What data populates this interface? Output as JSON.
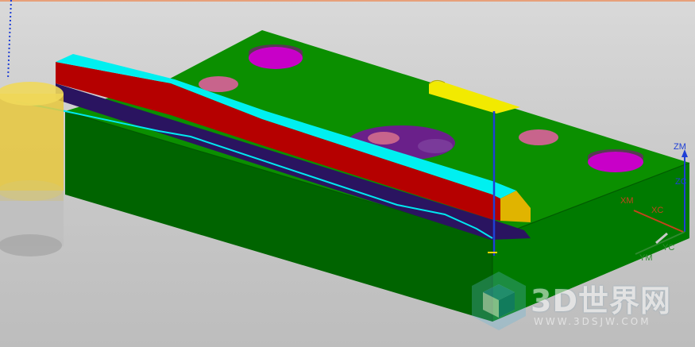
{
  "viewport": {
    "background": "#c9c9c9"
  },
  "colors": {
    "top_face": "#0a8c00",
    "side_face": "#007a00",
    "front_face": "#006600",
    "rail_red": "#b50000",
    "rail_cyan": "#00f0f0",
    "rail_dark": "#2a1460",
    "pocket_magenta": "#c800c8",
    "pocket_pink": "#c8648c",
    "pocket_purple": "#6a208a",
    "slot_yellow": "#f2ea00",
    "cylinder_yellow": "#e8c83c",
    "axis_z": "#1f3fd6",
    "axis_x": "#c4431c",
    "axis_y": "#2f8a2f"
  },
  "triad": {
    "zm": "ZM",
    "zc": "ZC",
    "xm": "XM",
    "xc": "XC",
    "ym": "YM",
    "yc": "YC"
  },
  "watermark": {
    "brand": "3D世界网",
    "url": "WWW.3DSJW.COM"
  }
}
